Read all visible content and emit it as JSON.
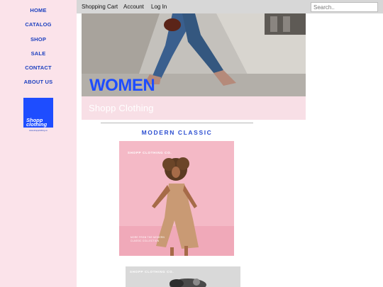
{
  "sidebar": {
    "nav": [
      "HOME",
      "CATALOG",
      "SHOP",
      "SALE",
      "CONTACT",
      "ABOUT US"
    ],
    "logo_lines": [
      "Shopp",
      "clothing"
    ],
    "logo_url": "www.shoppclothing.co"
  },
  "topbar": {
    "links": [
      "Shopping Cart",
      "Account",
      "Log In"
    ],
    "search_placeholder": "Search.."
  },
  "hero": {
    "title": "WOMEN",
    "caption": "Shopp Clothing"
  },
  "section": {
    "title": "MODERN CLASSIC"
  },
  "products": [
    {
      "brand": "SHOPP CLOTHING CO.",
      "copy_lines": [
        "MORE FROM THE MODERN",
        "CLASSIC COLLECTION"
      ]
    },
    {
      "brand": "SHOPP CLOTHING CO."
    }
  ],
  "colors": {
    "accent": "#1e4dff",
    "nav": "#1b3fbf",
    "sidebar_bg": "#fbe3ea",
    "topbar_bg": "#d7d7d7"
  }
}
